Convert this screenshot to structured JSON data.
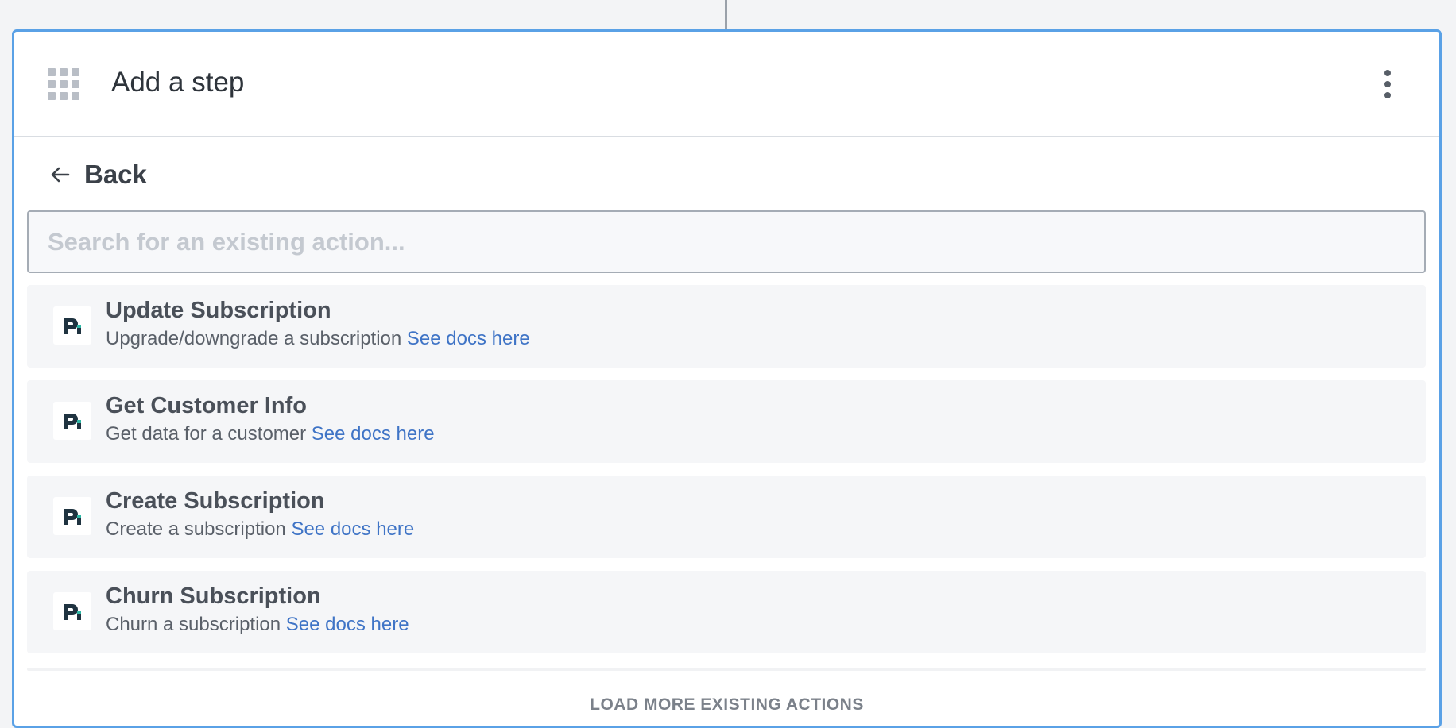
{
  "header": {
    "title": "Add a step",
    "apps_icon": "grid-icon",
    "menu_icon": "more-vertical-icon"
  },
  "back": {
    "label": "Back",
    "icon": "arrow-left-icon"
  },
  "search": {
    "value": "",
    "placeholder": "Search for an existing action..."
  },
  "actions": [
    {
      "title": "Update Subscription",
      "description": "Upgrade/downgrade a subscription",
      "link": "See docs here",
      "logo": "app-logo-icon"
    },
    {
      "title": "Get Customer Info",
      "description": "Get data for a customer",
      "link": "See docs here",
      "logo": "app-logo-icon"
    },
    {
      "title": "Create Subscription",
      "description": "Create a subscription",
      "link": "See docs here",
      "logo": "app-logo-icon"
    },
    {
      "title": "Churn Subscription",
      "description": "Churn a subscription",
      "link": "See docs here",
      "logo": "app-logo-icon"
    }
  ],
  "load_more": {
    "label": "LOAD MORE EXISTING ACTIONS"
  },
  "colors": {
    "accent_border": "#5aa1e6",
    "link": "#3f74c6",
    "logo_dark": "#1f3340",
    "logo_accent": "#2fb8a6"
  }
}
